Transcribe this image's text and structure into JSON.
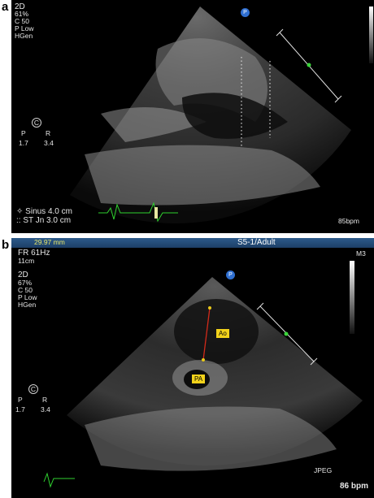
{
  "panel_a": {
    "letter": "a",
    "mode": "2D",
    "gain": "61%",
    "compress": "C 50",
    "power": "P Low",
    "freq": "HGen",
    "orient_p": "P",
    "orient_r": "R",
    "orient_c": "C",
    "scale_left": "1.7",
    "scale_right": "3.4",
    "meas1": "Sinus  4.0 cm",
    "meas2": "ST Jn  3.0 cm",
    "hr": "85bpm",
    "logo": "P"
  },
  "panel_b": {
    "letter": "b",
    "header_meas": "29.97 mm",
    "header_probe": "S5-1/Adult",
    "frame_rate": "FR 61Hz",
    "depth": "11cm",
    "mode": "2D",
    "gain": "67%",
    "compress": "C 50",
    "power": "P Low",
    "freq": "HGen",
    "m3": "M3",
    "orient_p": "P",
    "orient_r": "R",
    "orient_c": "C",
    "scale_left": "1.7",
    "scale_right": "3.4",
    "label_ao": "Ao",
    "label_pa": "PA",
    "format": "JPEG",
    "hr": "86 bpm",
    "logo": "P"
  }
}
